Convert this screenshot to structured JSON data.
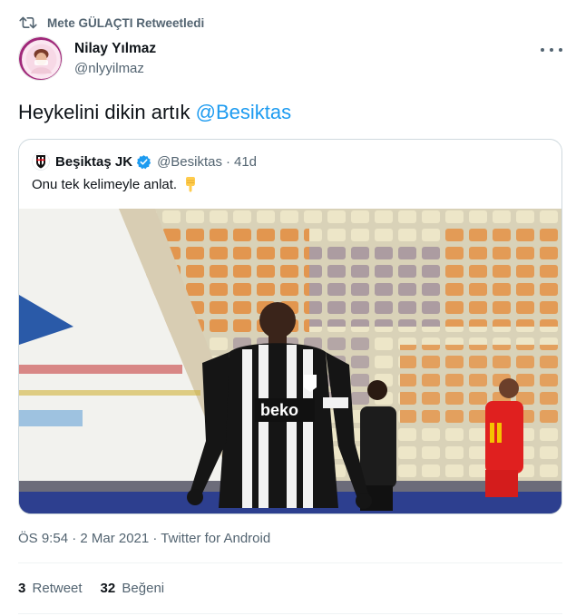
{
  "retweet_banner": {
    "icon": "retweet-icon",
    "text": "Mete GÜLAÇTI Retweetledi"
  },
  "author": {
    "name": "Nilay Yılmaz",
    "handle": "@nlyyilmaz",
    "avatar": "avatar"
  },
  "tweet": {
    "text": "Heykelini dikin artık ",
    "mention": "@Besiktas"
  },
  "quoted": {
    "name": "Beşiktaş JK",
    "verified": true,
    "handle": "@Besiktas",
    "separator": "·",
    "time": "41d",
    "text": "Onu tek kelimeyle anlat.",
    "emoji": "backhand-index-pointing-down",
    "media": "photo of footballer in black-and-white striped Beşiktaş kit on pitch"
  },
  "meta": {
    "text": "ÖS 9:54 · 2 Mar 2021 · Twitter for Android"
  },
  "stats": {
    "retweets_count": "3",
    "retweets_label": "Retweet",
    "likes_count": "32",
    "likes_label": "Beğeni"
  },
  "colors": {
    "accent": "#1d9bf0",
    "secondary_text": "#536471",
    "border": "#cfd9de"
  }
}
